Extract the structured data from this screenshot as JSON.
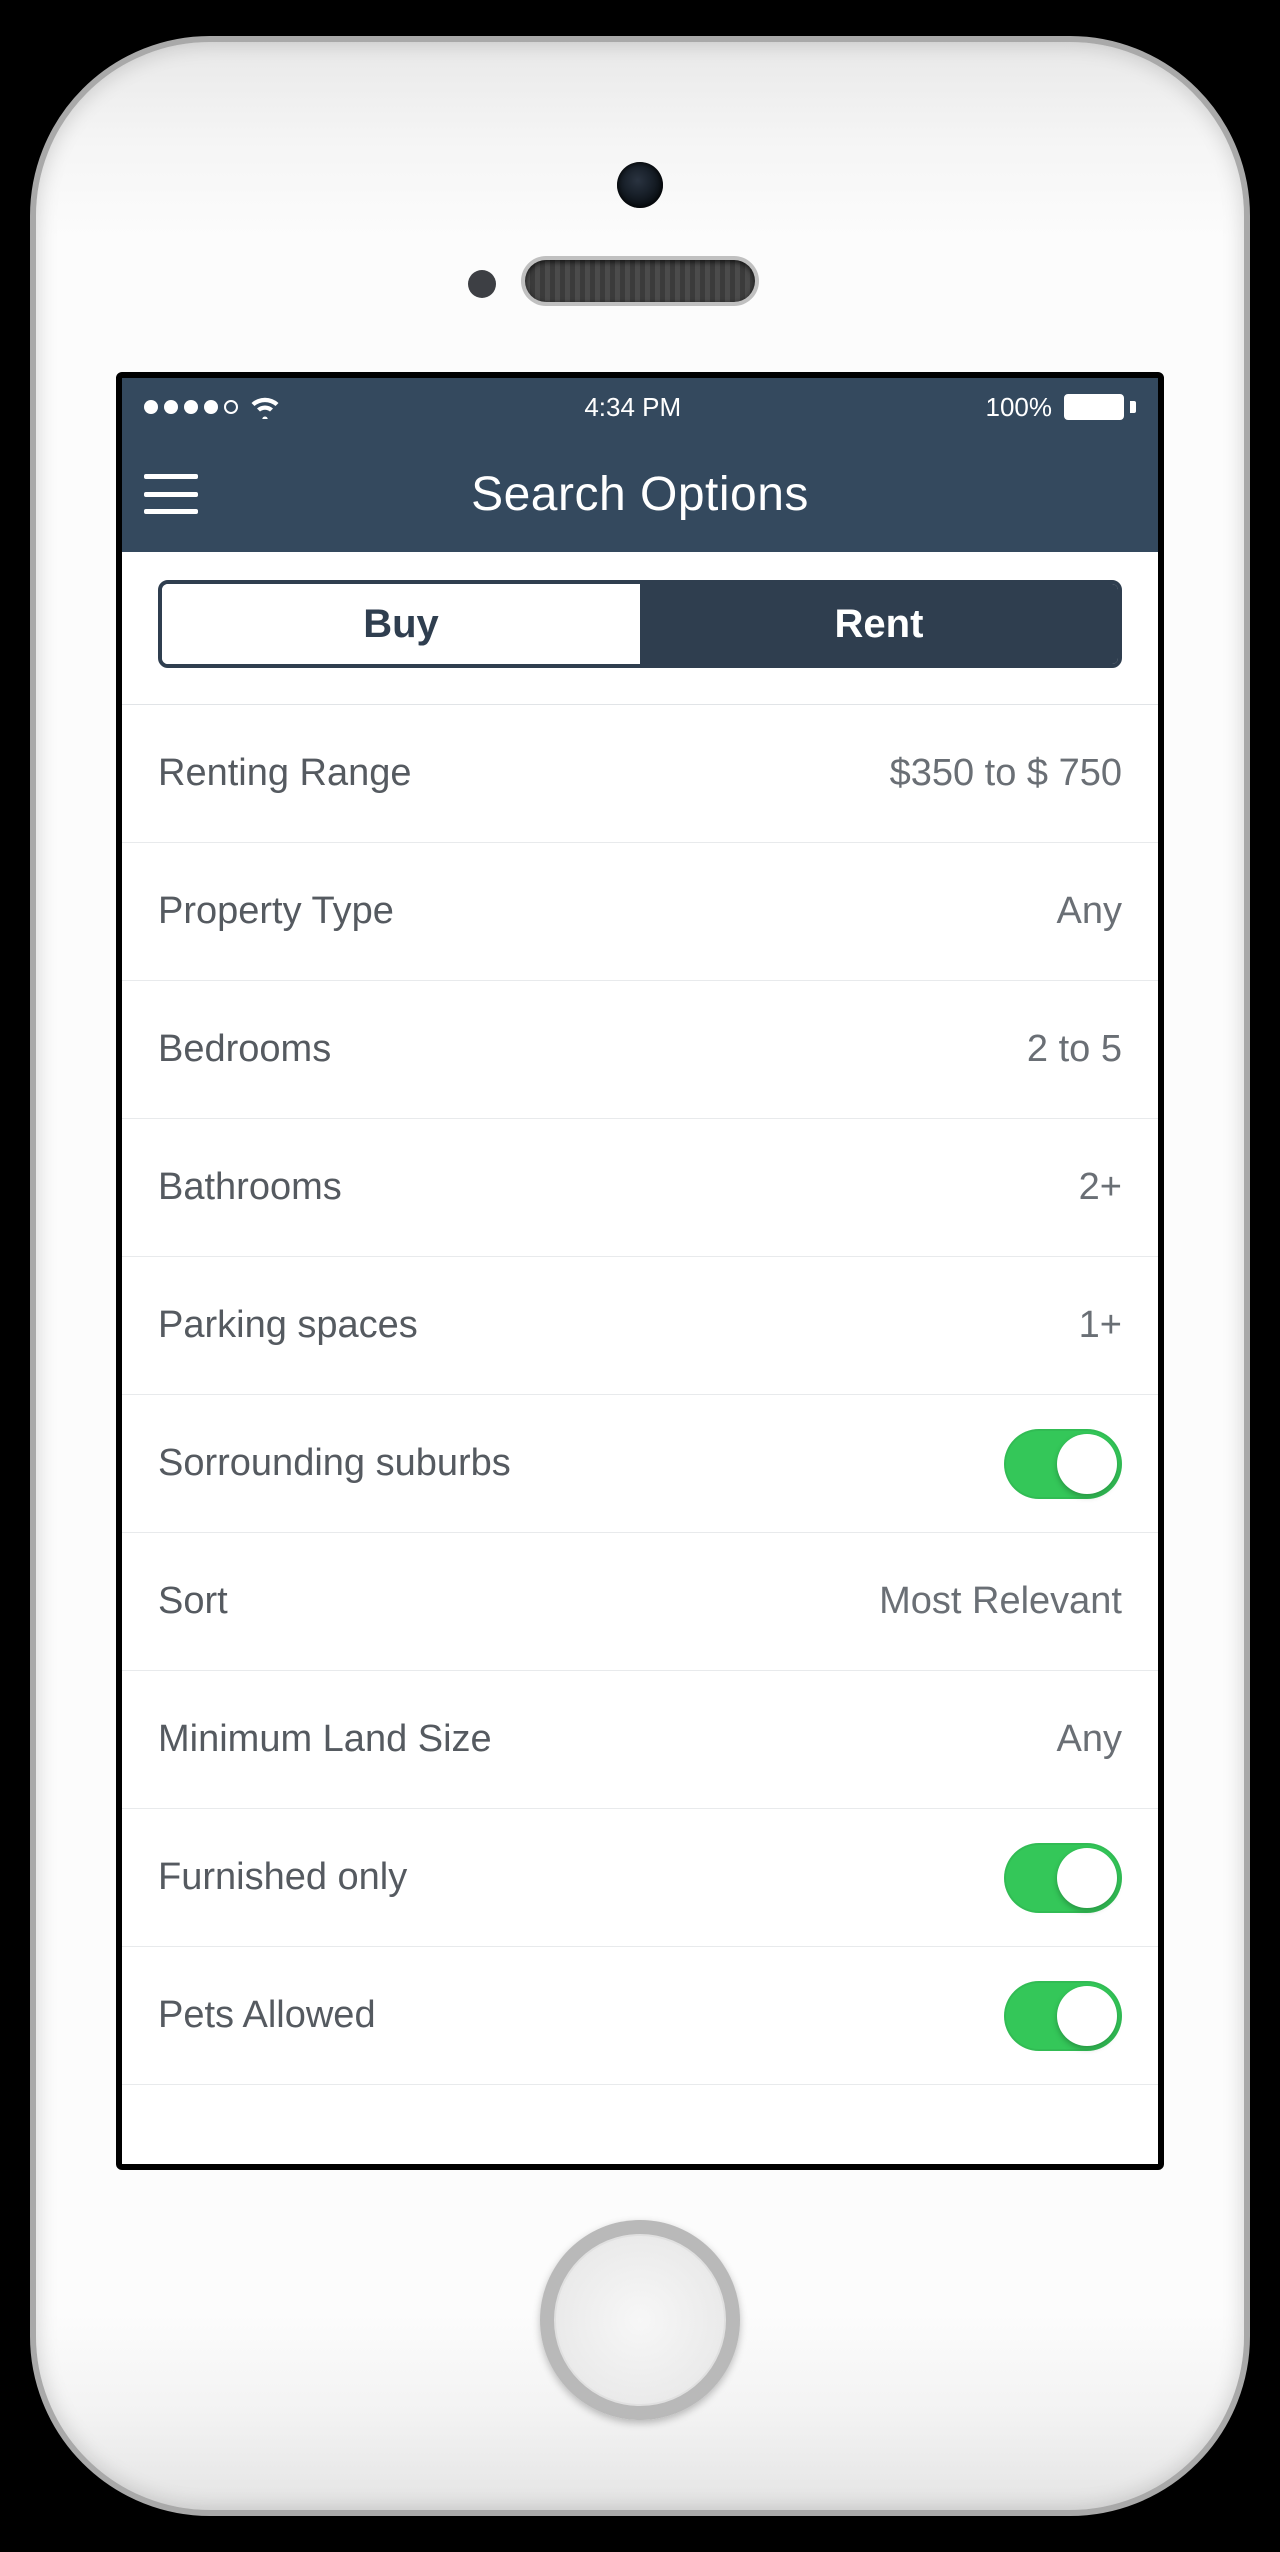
{
  "status": {
    "time": "4:34 PM",
    "battery_pct": "100%"
  },
  "navbar": {
    "title": "Search Options"
  },
  "segmented": {
    "buy": "Buy",
    "rent": "Rent",
    "selected": "Rent"
  },
  "filters": {
    "renting_range": {
      "label": "Renting Range",
      "value": "$350 to $ 750"
    },
    "property_type": {
      "label": "Property Type",
      "value": "Any"
    },
    "bedrooms": {
      "label": "Bedrooms",
      "value": "2 to 5"
    },
    "bathrooms": {
      "label": "Bathrooms",
      "value": "2+"
    },
    "parking": {
      "label": "Parking spaces",
      "value": "1+"
    },
    "surrounding": {
      "label": "Sorrounding suburbs",
      "on": true
    },
    "sort": {
      "label": "Sort",
      "value": "Most Relevant"
    },
    "min_land": {
      "label": "Minimum Land Size",
      "value": "Any"
    },
    "furnished": {
      "label": "Furnished only",
      "on": true
    },
    "pets": {
      "label": "Pets Allowed",
      "on": true
    }
  }
}
